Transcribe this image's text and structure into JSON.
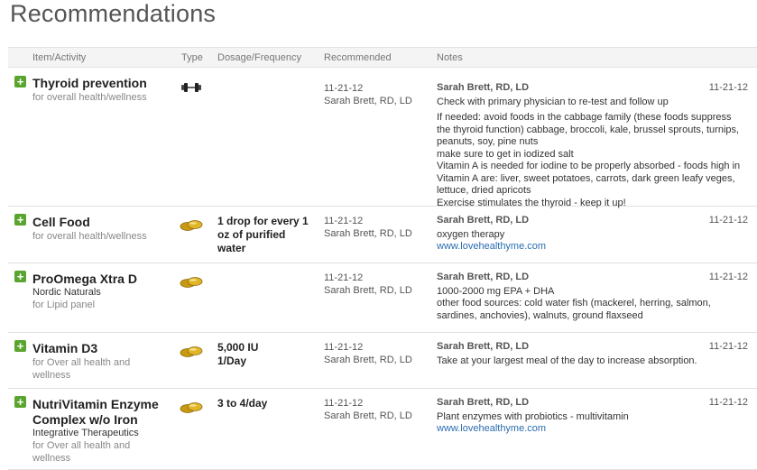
{
  "page_title": "Recommendations",
  "columns": {
    "item": "Item/Activity",
    "type": "Type",
    "dosage": "Dosage/Frequency",
    "recommended": "Recommended",
    "notes": "Notes"
  },
  "icons": {
    "add": "plus-icon",
    "activity": "dumbbell-icon",
    "supplement": "pill-icon"
  },
  "colors": {
    "add": "#5aa530",
    "link": "#2a6db0"
  },
  "rows": [
    {
      "add_label": "+",
      "name": "Thyroid prevention",
      "reason": "for overall health/wellness",
      "type": "activity",
      "rec_date": "11-21-12",
      "rec_by": "Sarah Brett, RD, LD",
      "note_author": "Sarah Brett, RD, LD",
      "note_date": "11-21-12",
      "note_lines": [
        "Check with primary physician to re-test and follow up",
        "If needed: avoid foods in the cabbage family (these foods suppress",
        "the thyroid function) cabbage, broccoli, kale, brussel sprouts, turnips,",
        "peanuts, soy, pine nuts",
        "make sure to get in iodized salt",
        "Vitamin A is needed for iodine to be properly absorbed - foods high in",
        "Vitamin A are: liver, sweet potatoes, carrots, dark green leafy veges,",
        "lettuce, dried apricots",
        "Exercise stimulates the thyroid - keep it up!"
      ]
    },
    {
      "add_label": "+",
      "name": "Cell Food",
      "reason": "for overall health/wellness",
      "type": "supplement",
      "dosage_lines": [
        "1 drop for every 1",
        "oz of purified",
        "water"
      ],
      "rec_date": "11-21-12",
      "rec_by": "Sarah Brett, RD, LD",
      "note_author": "Sarah Brett, RD, LD",
      "note_date": "11-21-12",
      "note_lines": [
        "oxygen therapy"
      ],
      "note_link": "www.lovehealthyme.com"
    },
    {
      "add_label": "+",
      "name": "ProOmega Xtra D",
      "brand": "Nordic Naturals",
      "reason": "for Lipid panel",
      "type": "supplement",
      "rec_date": "11-21-12",
      "rec_by": "Sarah Brett, RD, LD",
      "note_author": "Sarah Brett, RD, LD",
      "note_date": "11-21-12",
      "note_lines": [
        "1000-2000 mg EPA + DHA",
        "other food sources: cold water fish (mackerel, herring, salmon,",
        "sardines, anchovies), walnuts, ground flaxseed"
      ]
    },
    {
      "add_label": "+",
      "name": "Vitamin D3",
      "reason_lines": [
        "for Over all health and",
        "wellness"
      ],
      "type": "supplement",
      "dosage_lines": [
        "5,000 IU",
        "1/Day"
      ],
      "rec_date": "11-21-12",
      "rec_by": "Sarah Brett, RD, LD",
      "note_author": "Sarah Brett, RD, LD",
      "note_date": "11-21-12",
      "note_lines": [
        "Take at your largest meal of the day to increase absorption."
      ]
    },
    {
      "add_label": "+",
      "name_lines": [
        "NutriVitamin Enzyme",
        "Complex w/o Iron"
      ],
      "brand": "Integrative Therapeutics",
      "reason_lines": [
        "for Over all health and",
        "wellness"
      ],
      "type": "supplement",
      "dosage_lines": [
        "3 to 4/day"
      ],
      "rec_date": "11-21-12",
      "rec_by": "Sarah Brett, RD, LD",
      "note_author": "Sarah Brett, RD, LD",
      "note_date": "11-21-12",
      "note_lines": [
        "Plant enzymes with probiotics - multivitamin"
      ],
      "note_link": "www.lovehealthyme.com"
    }
  ]
}
